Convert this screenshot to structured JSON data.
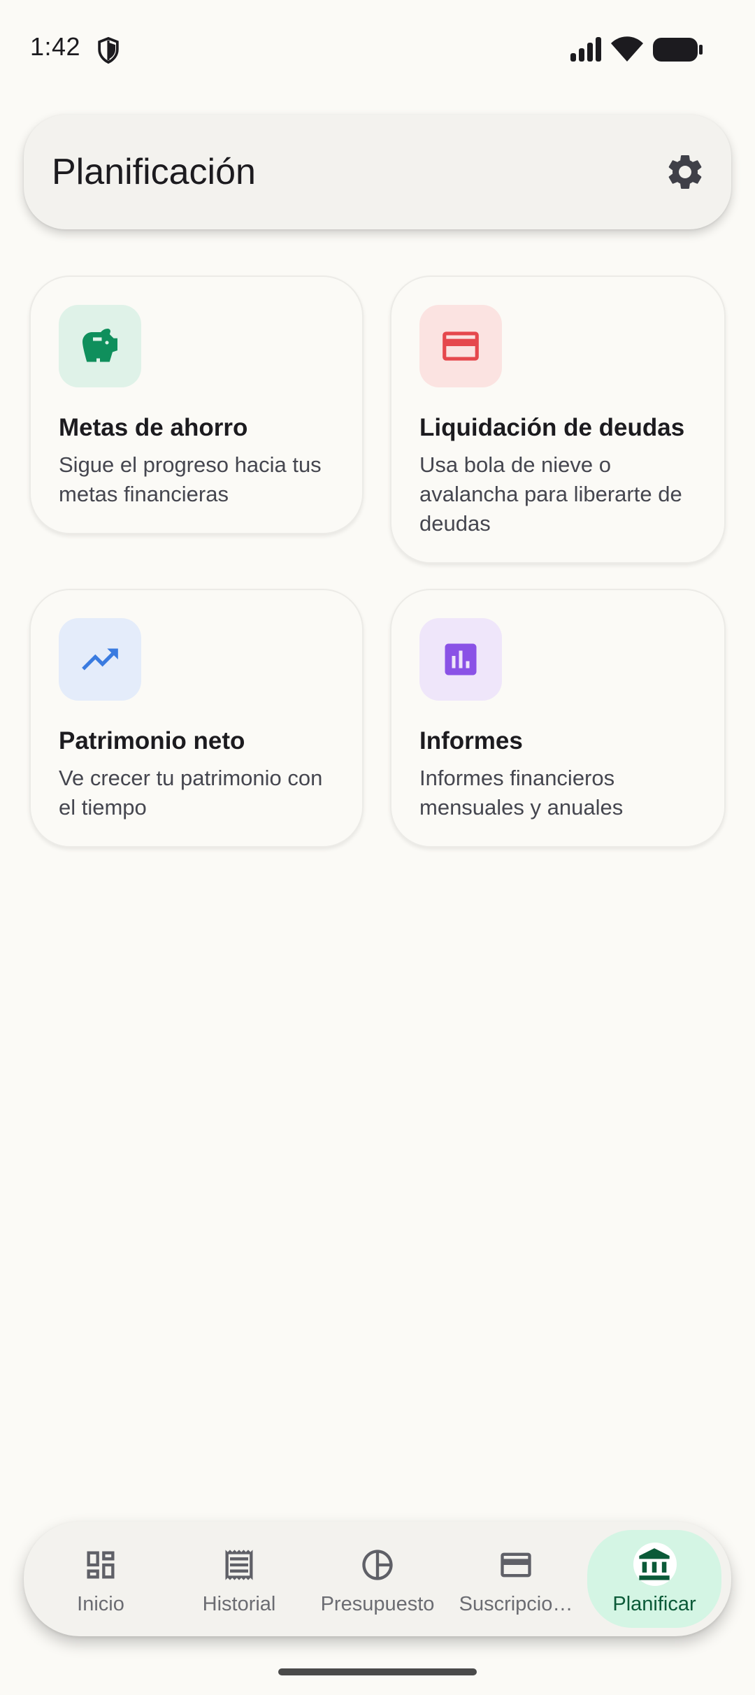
{
  "status_bar": {
    "time": "1:42",
    "icons": [
      "shield-icon",
      "signal-icon",
      "wifi-icon",
      "battery-icon"
    ]
  },
  "header": {
    "title": "Planificación",
    "settings_icon": "gear-icon"
  },
  "cards": [
    {
      "title": "Metas de ahorro",
      "description": "Sigue el progreso hacia tus metas financieras",
      "icon": "piggy-bank-icon",
      "icon_color": "#0f8f5c",
      "icon_bg": "#dff2e8"
    },
    {
      "title": "Liquidación de deudas",
      "description": "Usa bola de nieve o avalancha para liberarte de deudas",
      "icon": "credit-card-icon",
      "icon_color": "#e5484d",
      "icon_bg": "#fbe3e1"
    },
    {
      "title": "Patrimonio neto",
      "description": "Ve crecer tu patrimonio con el tiempo",
      "icon": "trending-up-icon",
      "icon_color": "#3a7be0",
      "icon_bg": "#e4ecfa"
    },
    {
      "title": "Informes",
      "description": "Informes financieros mensuales y anuales",
      "icon": "bar-chart-icon",
      "icon_color": "#8a52e6",
      "icon_bg": "#efe6fa"
    }
  ],
  "bottom_nav": {
    "items": [
      {
        "label": "Inicio",
        "icon": "dashboard-icon"
      },
      {
        "label": "Historial",
        "icon": "receipt-icon"
      },
      {
        "label": "Presupuesto",
        "icon": "pie-chart-icon"
      },
      {
        "label": "Suscripcio…",
        "icon": "credit-card-icon"
      },
      {
        "label": "Planificar",
        "icon": "bank-icon"
      }
    ],
    "active": "Planificar",
    "active_color": "#0b5a38",
    "active_bg": "#d4f5e4"
  }
}
